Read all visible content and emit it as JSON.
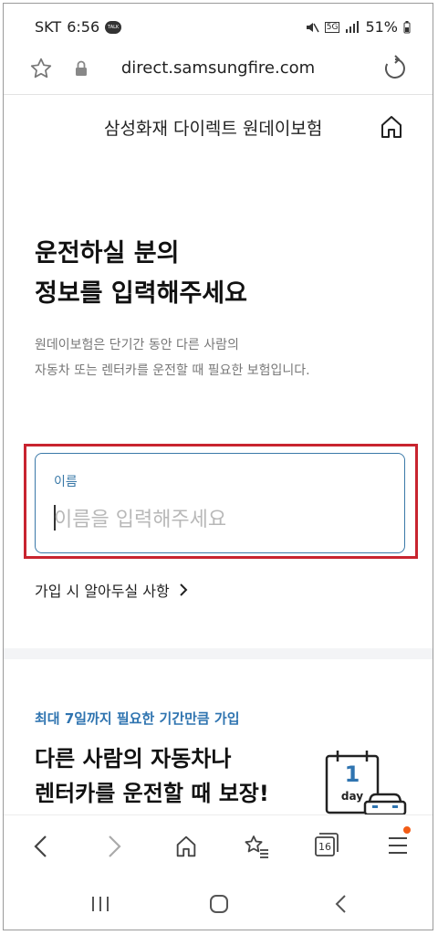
{
  "status_bar": {
    "carrier": "SKT",
    "time": "6:56",
    "network": "5G",
    "battery": "51%"
  },
  "browser": {
    "url": "direct.samsungfire.com",
    "tab_count": "16"
  },
  "site": {
    "title": "삼성화재 다이렉트 원데이보험"
  },
  "hero": {
    "title_line1": "운전하실 분의",
    "title_line2": "정보를 입력해주세요",
    "sub_line1": "원데이보험은 단기간 동안 다른 사람의",
    "sub_line2": "자동차 또는 렌터카를 운전할 때 필요한 보험입니다."
  },
  "name_field": {
    "label": "이름",
    "value": "",
    "placeholder": "이름을 입력해주세요"
  },
  "notice": {
    "label": "가입 시 알아두실 사항"
  },
  "promo": {
    "tag": "최대 7일까지 필요한 기간만큼 가입",
    "title_line1": "다른 사람의 자동차나",
    "title_line2": "렌터카를 운전할 때 보장!",
    "calendar_number": "1",
    "calendar_unit": "day"
  },
  "colors": {
    "accent_blue": "#3a79a8",
    "promo_blue": "#2f74b0",
    "highlight_red": "#c8242f",
    "notification_dot": "#f25c16"
  }
}
